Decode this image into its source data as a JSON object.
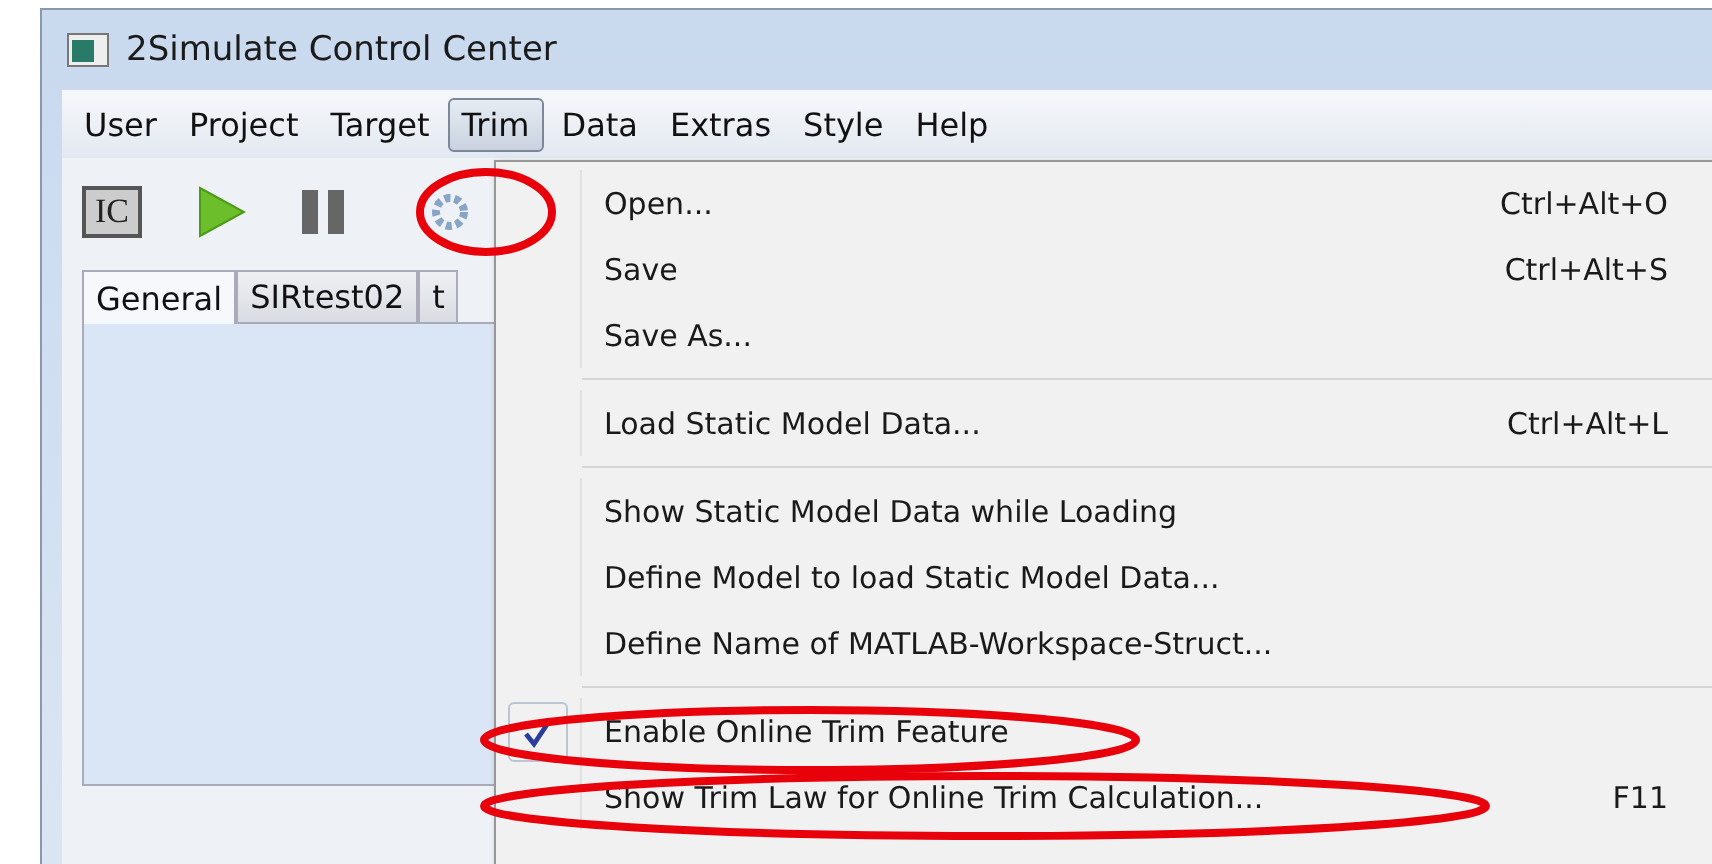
{
  "window": {
    "title": "2Simulate Control Center"
  },
  "menu_bar": [
    {
      "label": "User",
      "selected": false
    },
    {
      "label": "Project",
      "selected": false
    },
    {
      "label": "Target",
      "selected": false
    },
    {
      "label": "Trim",
      "selected": true
    },
    {
      "label": "Data",
      "selected": false
    },
    {
      "label": "Extras",
      "selected": false
    },
    {
      "label": "Style",
      "selected": false
    },
    {
      "label": "Help",
      "selected": false
    }
  ],
  "toolbar": [
    {
      "kind": "ic",
      "label": "IC",
      "circled": false
    },
    {
      "kind": "play",
      "circled": false
    },
    {
      "kind": "pause",
      "circled": false
    },
    {
      "kind": "gear",
      "circled": true
    }
  ],
  "tabs": [
    {
      "label": "General",
      "selected": true
    },
    {
      "label": "SIRtest02",
      "selected": false
    },
    {
      "label": "t",
      "selected": false
    }
  ],
  "trim_menu": [
    {
      "kind": "item",
      "label": "Open...",
      "shortcut": "Ctrl+Alt+O",
      "checked": false,
      "circled": false
    },
    {
      "kind": "item",
      "label": "Save",
      "shortcut": "Ctrl+Alt+S",
      "checked": false,
      "circled": false
    },
    {
      "kind": "item",
      "label": "Save As...",
      "checked": false,
      "circled": false
    },
    {
      "kind": "separator"
    },
    {
      "kind": "item",
      "label": "Load Static Model Data...",
      "shortcut": "Ctrl+Alt+L",
      "checked": false,
      "circled": false
    },
    {
      "kind": "separator"
    },
    {
      "kind": "item",
      "label": "Show Static Model Data while Loading",
      "checked": false,
      "circled": false
    },
    {
      "kind": "item",
      "label": "Define Model to load Static Model Data...",
      "checked": false,
      "circled": false
    },
    {
      "kind": "item",
      "label": "Define Name of MATLAB-Workspace-Struct...",
      "checked": false,
      "circled": false
    },
    {
      "kind": "separator"
    },
    {
      "kind": "item",
      "label": "Enable Online Trim Feature",
      "checked": true,
      "circled": true
    },
    {
      "kind": "item",
      "label": "Show Trim Law for Online Trim Calculation...",
      "shortcut": "F11",
      "checked": false,
      "circled": true
    }
  ]
}
